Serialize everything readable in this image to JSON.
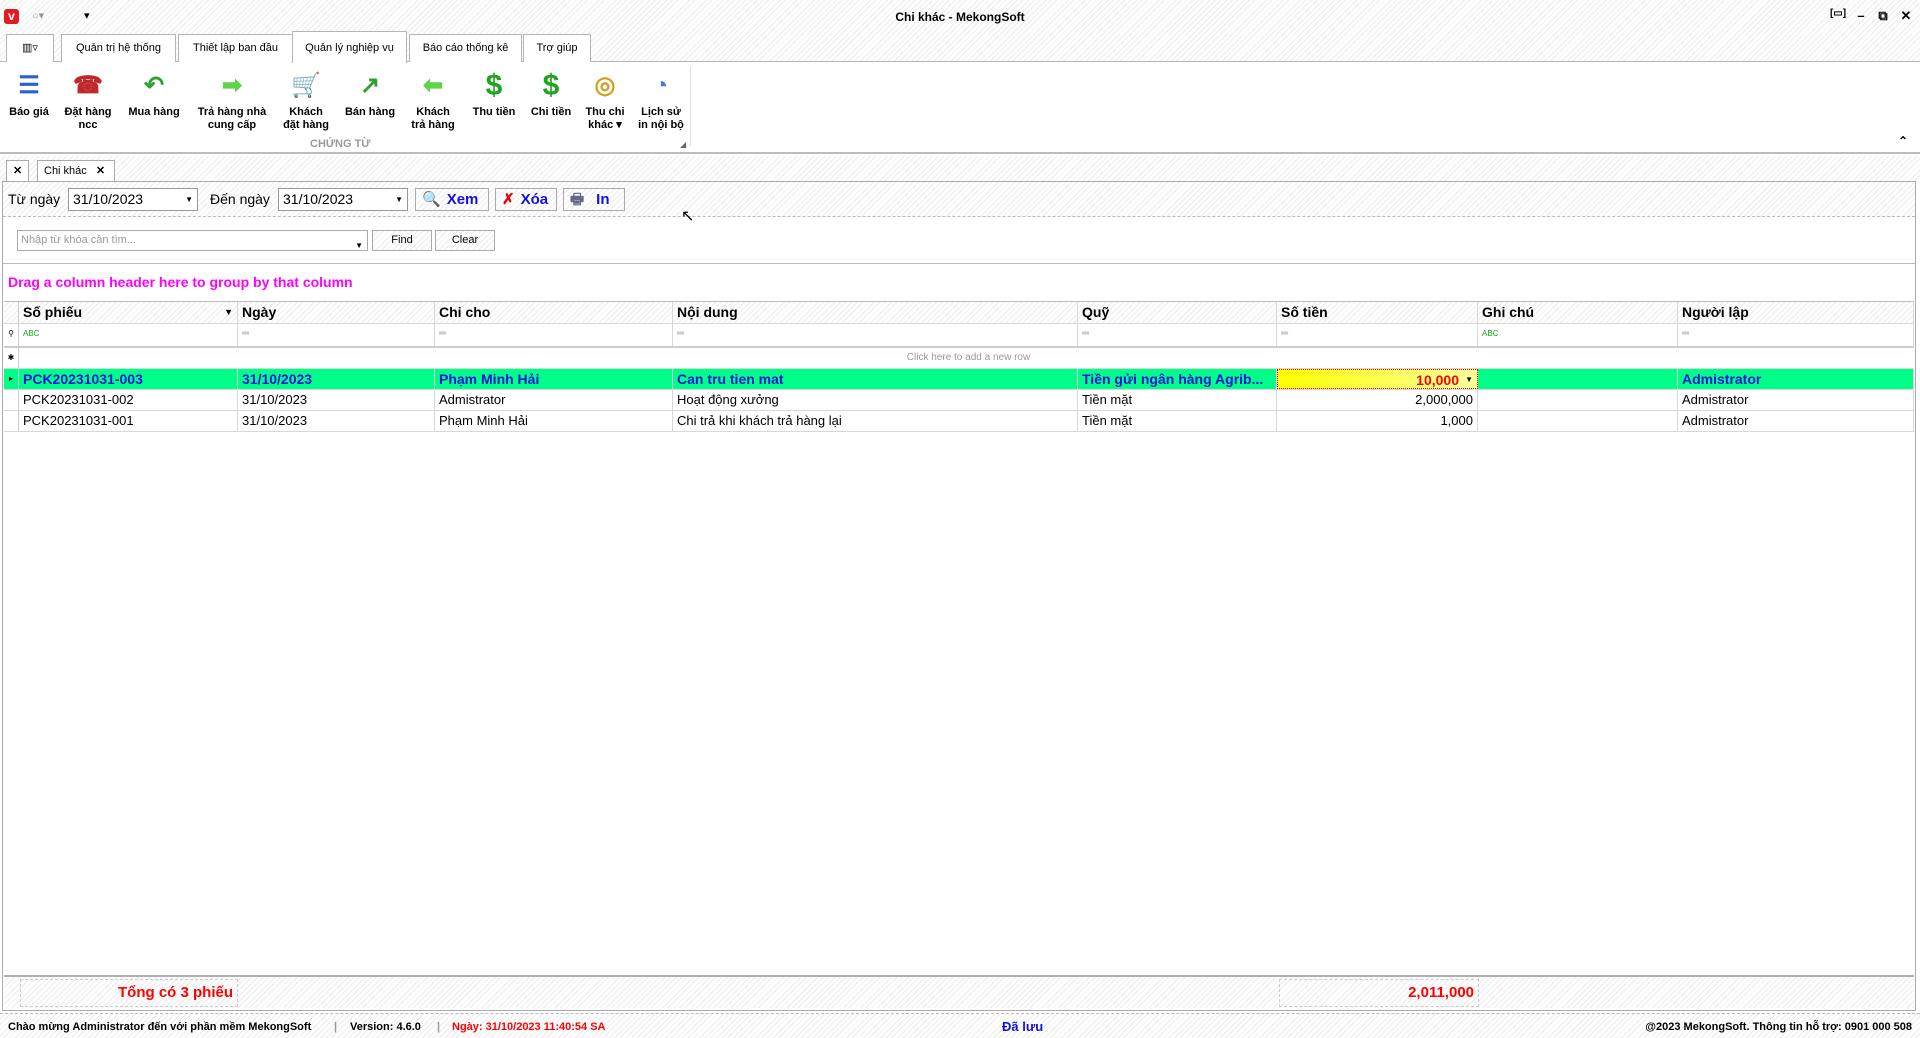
{
  "window": {
    "title": "Chi khác - MekongSoft"
  },
  "ribbon_tabs": [
    "Quản trị hệ thống",
    "Thiết lập ban đầu",
    "Quản lý nghiệp vụ",
    "Báo cáo thống kê",
    "Trợ giúp"
  ],
  "ribbon": {
    "group_label": "CHỨNG TỪ",
    "buttons": [
      {
        "l1": "Báo giá",
        "l2": "",
        "icon": "list-icon",
        "color": "#2d5fd0"
      },
      {
        "l1": "Đặt hàng",
        "l2": "ncc",
        "icon": "telephone-icon",
        "color": "#c0282a"
      },
      {
        "l1": "Mua hàng",
        "l2": "",
        "icon": "arrow-back-icon",
        "color": "#2fa12f"
      },
      {
        "l1": "Trả hàng nhà",
        "l2": "cung cấp",
        "icon": "arrow-right-icon",
        "color": "#5dd34a"
      },
      {
        "l1": "Khách",
        "l2": "đặt hàng",
        "icon": "cart-icon",
        "color": "#555555"
      },
      {
        "l1": "Bán hàng",
        "l2": "",
        "icon": "arrow-up-right-icon",
        "color": "#2fa12f"
      },
      {
        "l1": "Khách",
        "l2": "trả hàng",
        "icon": "arrow-left-icon",
        "color": "#5dd34a"
      },
      {
        "l1": "Thu tiền",
        "l2": "",
        "icon": "dollar-plus-icon",
        "color": "#1ea51e"
      },
      {
        "l1": "Chi tiền",
        "l2": "",
        "icon": "dollar-minus-icon",
        "color": "#1ea51e"
      },
      {
        "l1": "Thu chi",
        "l2": "khác ▾",
        "icon": "coins-icon",
        "color": "#d4a020"
      },
      {
        "l1": "Lịch sử",
        "l2": "in nội bộ",
        "icon": "history-icon",
        "color": "#3a7fd0"
      }
    ]
  },
  "doc_tab": "Chi khác",
  "filter": {
    "from_label": "Từ ngày",
    "from_value": "31/10/2023",
    "to_label": "Đến ngày",
    "to_value": "31/10/2023",
    "view": "Xem",
    "delete": "Xóa",
    "print": "In"
  },
  "search": {
    "placeholder": "Nhập từ khóa cần tìm...",
    "find": "Find",
    "clear": "Clear"
  },
  "grid": {
    "group_hint": "Drag a column header here to group by that column",
    "new_row_hint": "Click here to add a new row",
    "columns": [
      "Số phiếu",
      "Ngày",
      "Chi cho",
      "Nội dung",
      "Quỹ",
      "Số tiền",
      "Ghi chú",
      "Người lập"
    ],
    "rows": [
      [
        "PCK20231031-003",
        "31/10/2023",
        "Phạm Minh Hải",
        "Can tru tien mat",
        "Tiền gửi ngân hàng Agrib...",
        "10,000",
        "",
        "Admistrator"
      ],
      [
        "PCK20231031-002",
        "31/10/2023",
        "Admistrator",
        "Hoạt động xưởng",
        "Tiền mặt",
        "2,000,000",
        "",
        "Admistrator"
      ],
      [
        "PCK20231031-001",
        "31/10/2023",
        "Phạm Minh Hải",
        "Chi trả khi khách trả hàng lại",
        "Tiền mặt",
        "1,000",
        "",
        "Admistrator"
      ]
    ],
    "footer_count": "Tổng có 3 phiếu",
    "footer_total": "2,011,000"
  },
  "status": {
    "welcome": "Chào mừng Administrator đến với phần mềm MekongSoft",
    "version": "Version: 4.6.0",
    "date": "Ngày: 31/10/2023 11:40:54 SA",
    "saved": "Đã lưu",
    "copyright": "@2023 MekongSoft. Thông tin hỗ trợ: 0901 000 508"
  },
  "colors": {
    "selected_row": "#00ff88",
    "selected_text": "#1010e0",
    "editing_cell": "#ffff40",
    "total": "#ff0000",
    "group_hint": "#ff00ff"
  }
}
